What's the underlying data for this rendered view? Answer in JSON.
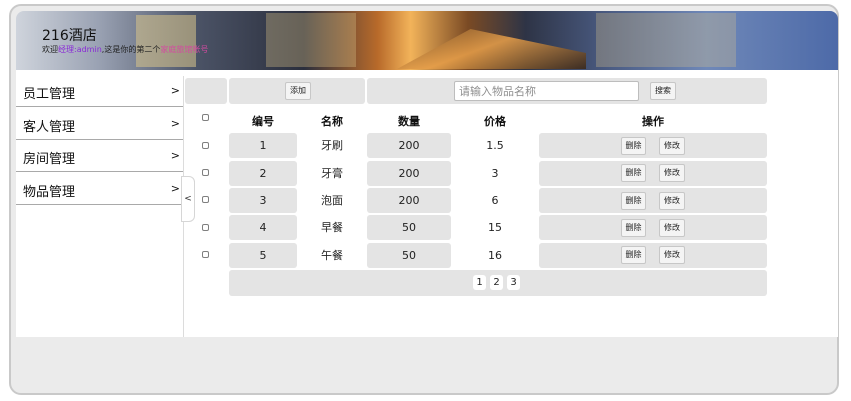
{
  "header": {
    "title": "216酒店",
    "welcome_prefix": "欢迎",
    "welcome_role": "经理:",
    "welcome_user": "admin",
    "welcome_mid": ",这是你的第",
    "welcome_count": "二",
    "welcome_suffix": "个",
    "welcome_tail": "家庭旅馆帐号"
  },
  "sidebar": {
    "items": [
      {
        "label": "员工管理",
        "arrow": ">"
      },
      {
        "label": "客人管理",
        "arrow": ">"
      },
      {
        "label": "房间管理",
        "arrow": ">"
      },
      {
        "label": "物品管理",
        "arrow": ">"
      }
    ],
    "collapse_label": "<"
  },
  "toolbar": {
    "add_label": "添加",
    "search_placeholder": "请输入物品名称",
    "search_label": "搜索"
  },
  "table": {
    "columns": [
      "编号",
      "名称",
      "数量",
      "价格",
      "操作"
    ],
    "rows": [
      {
        "id": "1",
        "name": "牙刷",
        "qty": "200",
        "price": "1.5"
      },
      {
        "id": "2",
        "name": "牙膏",
        "qty": "200",
        "price": "3"
      },
      {
        "id": "3",
        "name": "泡面",
        "qty": "200",
        "price": "6"
      },
      {
        "id": "4",
        "name": "早餐",
        "qty": "50",
        "price": "15"
      },
      {
        "id": "5",
        "name": "午餐",
        "qty": "50",
        "price": "16"
      }
    ],
    "delete_label": "删除",
    "edit_label": "修改"
  },
  "pagination": {
    "pages": [
      "1",
      "2",
      "3"
    ]
  }
}
